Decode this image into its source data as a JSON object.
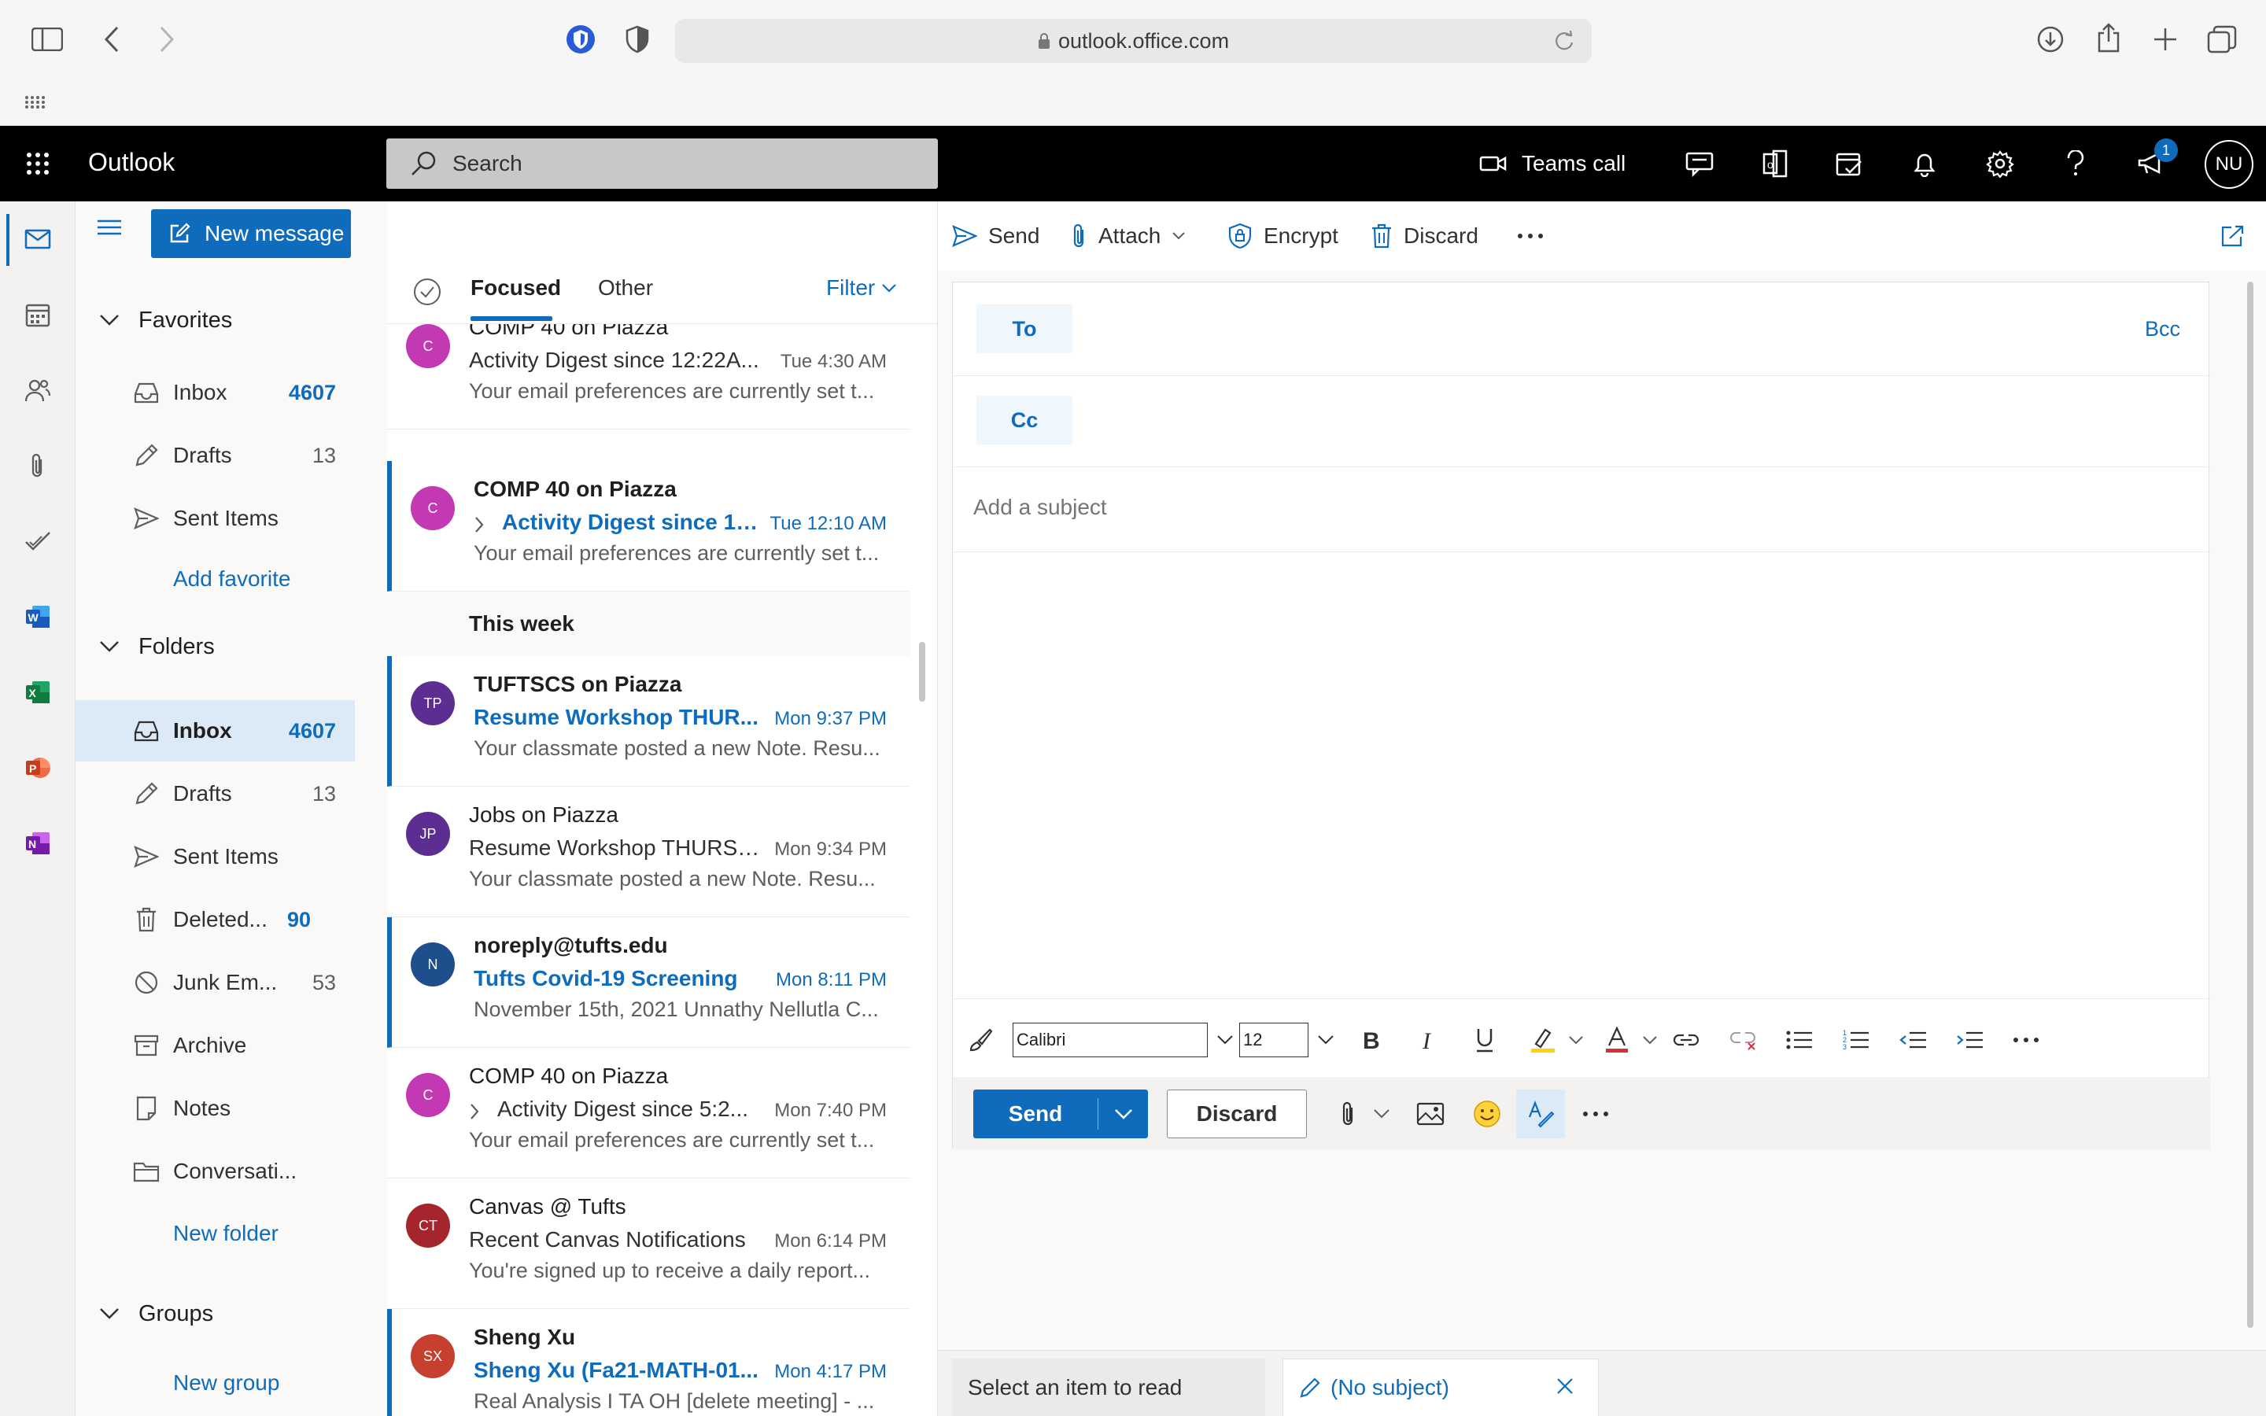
{
  "browser": {
    "url": "outlook.office.com"
  },
  "app": {
    "title": "Outlook",
    "search_placeholder": "Search",
    "teams_call": "Teams call",
    "notification_count": "1",
    "user_initials": "NU"
  },
  "folder_pane": {
    "new_message": "New message",
    "favorites_header": "Favorites",
    "favorites": [
      {
        "label": "Inbox",
        "count": "4607"
      },
      {
        "label": "Drafts",
        "count": "13"
      },
      {
        "label": "Sent Items",
        "count": ""
      }
    ],
    "add_favorite": "Add favorite",
    "folders_header": "Folders",
    "folders": [
      {
        "label": "Inbox",
        "count": "4607"
      },
      {
        "label": "Drafts",
        "count": "13"
      },
      {
        "label": "Sent Items",
        "count": ""
      },
      {
        "label": "Deleted...",
        "count": "90"
      },
      {
        "label": "Junk Em...",
        "count": "53"
      },
      {
        "label": "Archive",
        "count": ""
      },
      {
        "label": "Notes",
        "count": ""
      },
      {
        "label": "Conversati...",
        "count": ""
      }
    ],
    "new_folder": "New folder",
    "groups_header": "Groups",
    "new_group": "New group"
  },
  "message_list": {
    "tab_focused": "Focused",
    "tab_other": "Other",
    "filter": "Filter",
    "group_this_week": "This week",
    "messages": [
      {
        "initials": "C",
        "color": "#c239b3",
        "sender": "COMP 40 on Piazza",
        "subject": "Activity Digest since 12:22A...",
        "time": "Tue 4:30 AM",
        "preview": "Your email preferences are currently set t..."
      },
      {
        "initials": "C",
        "color": "#c239b3",
        "sender": "COMP 40 on Piazza",
        "subject": "Activity Digest since 10:...",
        "time": "Tue 12:10 AM",
        "preview": "Your email preferences are currently set t..."
      },
      {
        "initials": "TP",
        "color": "#5c2e91",
        "sender": "TUFTSCS on Piazza",
        "subject": "Resume Workshop THUR...",
        "time": "Mon 9:37 PM",
        "preview": "Your classmate posted a new Note. Resu..."
      },
      {
        "initials": "JP",
        "color": "#5c2e91",
        "sender": "Jobs on Piazza",
        "subject": "Resume Workshop THURS ...",
        "time": "Mon 9:34 PM",
        "preview": "Your classmate posted a new Note. Resu..."
      },
      {
        "initials": "N",
        "color": "#1e4e8c",
        "sender": "noreply@tufts.edu",
        "subject": "Tufts Covid-19 Screening",
        "time": "Mon 8:11 PM",
        "preview": "November 15th, 2021 Unnathy Nellutla C..."
      },
      {
        "initials": "C",
        "color": "#c239b3",
        "sender": "COMP 40 on Piazza",
        "subject": "Activity Digest since 5:2...",
        "time": "Mon 7:40 PM",
        "preview": "Your email preferences are currently set t..."
      },
      {
        "initials": "CT",
        "color": "#a4262c",
        "sender": "Canvas @ Tufts",
        "subject": "Recent Canvas Notifications",
        "time": "Mon 6:14 PM",
        "preview": "You're signed up to receive a daily report..."
      },
      {
        "initials": "SX",
        "color": "#c7402f",
        "sender": "Sheng Xu",
        "subject": "Sheng Xu (Fa21-MATH-01...",
        "time": "Mon 4:17 PM",
        "preview": "Real Analysis I TA OH [delete meeting] - ..."
      }
    ]
  },
  "command_bar": {
    "send": "Send",
    "attach": "Attach",
    "encrypt": "Encrypt",
    "discard": "Discard"
  },
  "compose": {
    "to": "To",
    "cc": "Cc",
    "bcc": "Bcc",
    "subject_placeholder": "Add a subject",
    "font_name": "Calibri",
    "font_size": "12",
    "send": "Send",
    "discard": "Discard"
  },
  "bottom_tabs": {
    "read": "Select an item to read",
    "draft": "(No subject)"
  },
  "colors": {
    "accent": "#0f6cbd",
    "app_bar": "#000000"
  }
}
